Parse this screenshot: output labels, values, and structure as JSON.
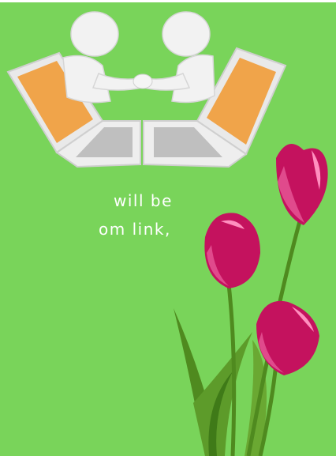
{
  "image": {
    "illustration": "two-figures-shaking-hands-from-laptops",
    "decoration": "pink-tulips",
    "background_color": "#79d45a"
  },
  "text": {
    "line1": "will be",
    "line2": "om link,"
  }
}
